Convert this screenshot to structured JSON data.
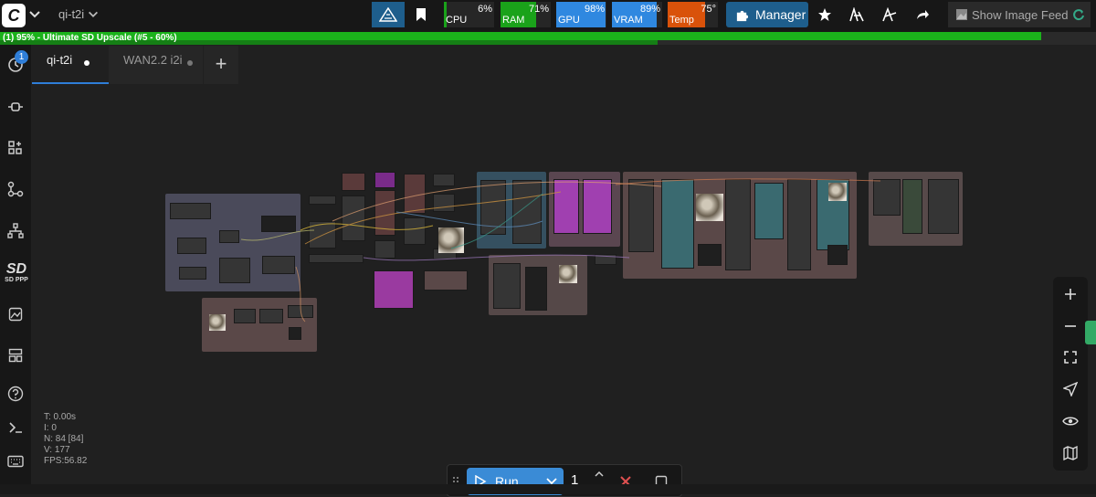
{
  "app": {
    "logo_letter": "C"
  },
  "workflow": {
    "title": "qi-t2i"
  },
  "toolbar": {
    "meters": [
      {
        "label": "CPU",
        "percent": "6%",
        "value": 0.06,
        "color": "#1aa21a"
      },
      {
        "label": "RAM",
        "percent": "71%",
        "value": 0.71,
        "color": "#1aa21a"
      },
      {
        "label": "GPU",
        "percent": "98%",
        "value": 0.98,
        "color": "#2f88e0"
      },
      {
        "label": "VRAM",
        "percent": "89%",
        "value": 0.89,
        "color": "#2f88e0"
      },
      {
        "label": "Temp",
        "percent": "75°",
        "value": 0.75,
        "color": "#d9520a"
      }
    ],
    "manager_label": "Manager",
    "show_feed_label": "Show Image Feed"
  },
  "progress": {
    "text": "(1) 95% - Ultimate SD Upscale (#5 - 60%)",
    "overall": 0.95,
    "node": 0.6
  },
  "sidebar": {
    "queue_badge": "1",
    "sdppp_big": "SD",
    "sdppp_small": "SD PPP"
  },
  "tabs": [
    {
      "label": "qi-t2i",
      "active": true
    },
    {
      "label": "WAN2.2 i2i",
      "active": false
    }
  ],
  "tab_add_label": "+",
  "stats": {
    "t": "T: 0.00s",
    "i": "I: 0",
    "n": "N: 84 [84]",
    "v": "V: 177",
    "fps": "FPS:56.82"
  },
  "runbar": {
    "run_label": "Run",
    "batch_count": "1"
  },
  "colors": {
    "accent": "#2f7ed8",
    "run": "#3a8bd6",
    "progress": "#1bb21b"
  }
}
